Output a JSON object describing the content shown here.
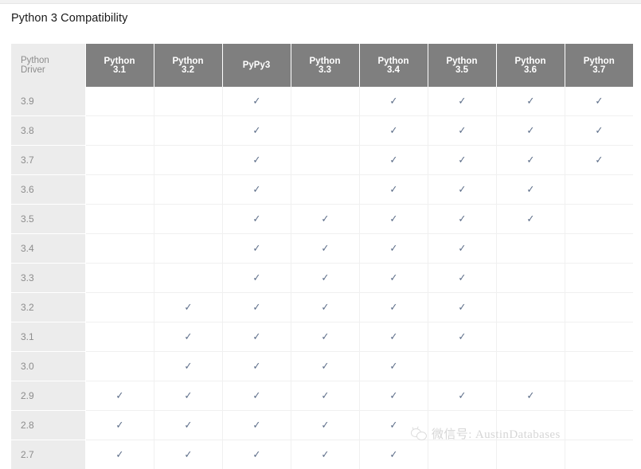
{
  "page_title": "Python 3 Compatibility",
  "watermark": {
    "icon": "wechat-icon",
    "text": "微信号: AustinDatabases"
  },
  "colors": {
    "header_bg": "#7f7f7f",
    "header_text": "#ffffff",
    "rowlabel_bg": "#ececec",
    "rowlabel_text": "#8c8c8c",
    "check_color": "#5a6b87",
    "grid_line": "#f0f0f0",
    "page_bg": "#ffffff",
    "watermark_color": "#d6d6d6"
  },
  "table": {
    "corner_header": {
      "line1": "Python",
      "line2": "Driver"
    },
    "columns": [
      {
        "id": "py31",
        "line1": "Python",
        "line2": "3.1"
      },
      {
        "id": "py32",
        "line1": "Python",
        "line2": "3.2"
      },
      {
        "id": "pypy3",
        "line1": "PyPy3",
        "line2": ""
      },
      {
        "id": "py33",
        "line1": "Python",
        "line2": "3.3"
      },
      {
        "id": "py34",
        "line1": "Python",
        "line2": "3.4"
      },
      {
        "id": "py35",
        "line1": "Python",
        "line2": "3.5"
      },
      {
        "id": "py36",
        "line1": "Python",
        "line2": "3.6"
      },
      {
        "id": "py37",
        "line1": "Python",
        "line2": "3.7"
      }
    ],
    "check_glyph": "✓",
    "rows": [
      {
        "label": "3.9",
        "cells": [
          "",
          "",
          "✓",
          "",
          "✓",
          "✓",
          "✓",
          "✓"
        ]
      },
      {
        "label": "3.8",
        "cells": [
          "",
          "",
          "✓",
          "",
          "✓",
          "✓",
          "✓",
          "✓"
        ]
      },
      {
        "label": "3.7",
        "cells": [
          "",
          "",
          "✓",
          "",
          "✓",
          "✓",
          "✓",
          "✓"
        ]
      },
      {
        "label": "3.6",
        "cells": [
          "",
          "",
          "✓",
          "",
          "✓",
          "✓",
          "✓",
          ""
        ]
      },
      {
        "label": "3.5",
        "cells": [
          "",
          "",
          "✓",
          "✓",
          "✓",
          "✓",
          "✓",
          ""
        ]
      },
      {
        "label": "3.4",
        "cells": [
          "",
          "",
          "✓",
          "✓",
          "✓",
          "✓",
          "",
          ""
        ]
      },
      {
        "label": "3.3",
        "cells": [
          "",
          "",
          "✓",
          "✓",
          "✓",
          "✓",
          "",
          ""
        ]
      },
      {
        "label": "3.2",
        "cells": [
          "",
          "✓",
          "✓",
          "✓",
          "✓",
          "✓",
          "",
          ""
        ]
      },
      {
        "label": "3.1",
        "cells": [
          "",
          "✓",
          "✓",
          "✓",
          "✓",
          "✓",
          "",
          ""
        ]
      },
      {
        "label": "3.0",
        "cells": [
          "",
          "✓",
          "✓",
          "✓",
          "✓",
          "",
          "",
          ""
        ]
      },
      {
        "label": "2.9",
        "cells": [
          "✓",
          "✓",
          "✓",
          "✓",
          "✓",
          "✓",
          "✓",
          ""
        ]
      },
      {
        "label": "2.8",
        "cells": [
          "✓",
          "✓",
          "✓",
          "✓",
          "✓",
          "",
          "",
          ""
        ]
      },
      {
        "label": "2.7",
        "cells": [
          "✓",
          "✓",
          "✓",
          "✓",
          "✓",
          "",
          "",
          ""
        ]
      }
    ]
  }
}
